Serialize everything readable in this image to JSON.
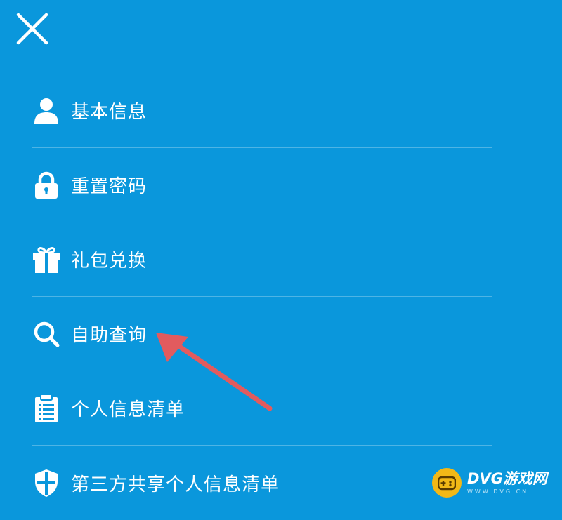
{
  "menu": {
    "items": [
      {
        "label": "基本信息",
        "icon": "user-icon"
      },
      {
        "label": "重置密码",
        "icon": "lock-icon"
      },
      {
        "label": "礼包兑换",
        "icon": "gift-icon"
      },
      {
        "label": "自助查询",
        "icon": "search-icon"
      },
      {
        "label": "个人信息清单",
        "icon": "clipboard-icon"
      },
      {
        "label": "第三方共享个人信息清单",
        "icon": "shield-icon"
      }
    ]
  },
  "watermark": {
    "title": "DVG游戏网",
    "subtitle": "WWW.DVG.CN"
  },
  "colors": {
    "background": "#0a97dc",
    "foreground": "#ffffff",
    "arrow": "#e25b5e",
    "watermark_badge": "#f2b817"
  }
}
